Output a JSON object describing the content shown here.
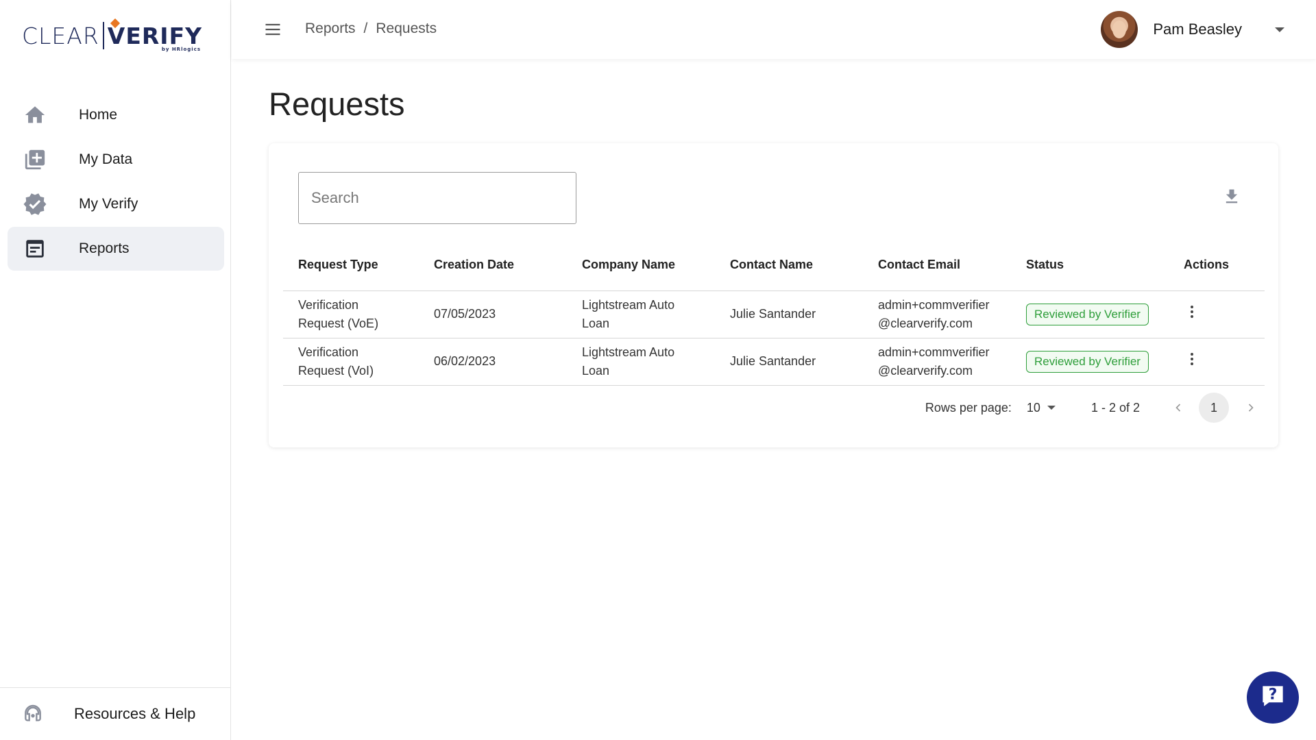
{
  "brand": {
    "logo_left": "CLEAR",
    "logo_right": "ERIFY",
    "logo_check": "V",
    "byline": "by HRlogics"
  },
  "sidebar": {
    "items": [
      {
        "label": "Home",
        "icon": "home-icon",
        "active": false
      },
      {
        "label": "My Data",
        "icon": "document-add-icon",
        "active": false
      },
      {
        "label": "My Verify",
        "icon": "verified-badge-icon",
        "active": false
      },
      {
        "label": "Reports",
        "icon": "report-icon",
        "active": true
      }
    ],
    "footer": {
      "label": "Resources & Help",
      "icon": "headset-icon"
    }
  },
  "header": {
    "breadcrumb": [
      "Reports",
      "Requests"
    ],
    "breadcrumb_sep": "/",
    "user_name": "Pam Beasley"
  },
  "main": {
    "title": "Requests",
    "search": {
      "placeholder": "Search",
      "value": ""
    },
    "table": {
      "columns": [
        "Request Type",
        "Creation Date",
        "Company Name",
        "Contact Name",
        "Contact Email",
        "Status",
        "Actions"
      ],
      "rows": [
        {
          "type": "Verification Request (VoE)",
          "date": "07/05/2023",
          "company": "Lightstream Auto Loan",
          "contact": "Julie Santander",
          "email": "admin+commverifier@clearverify.com",
          "status": "Reviewed by Verifier"
        },
        {
          "type": "Verification Request (VoI)",
          "date": "06/02/2023",
          "company": "Lightstream Auto Loan",
          "contact": "Julie Santander",
          "email": "admin+commverifier@clearverify.com",
          "status": "Reviewed by Verifier"
        }
      ]
    },
    "pagination": {
      "rows_per_page_label": "Rows per page:",
      "rows_per_page": "10",
      "range": "1 - 2 of 2",
      "current_page": "1"
    }
  },
  "colors": {
    "accent": "#1c2b8c",
    "status_green": "#2e9e3a",
    "brand_navy": "#1f2a5a",
    "brand_orange": "#e87722",
    "active_nav_bg": "#eef0f4"
  }
}
